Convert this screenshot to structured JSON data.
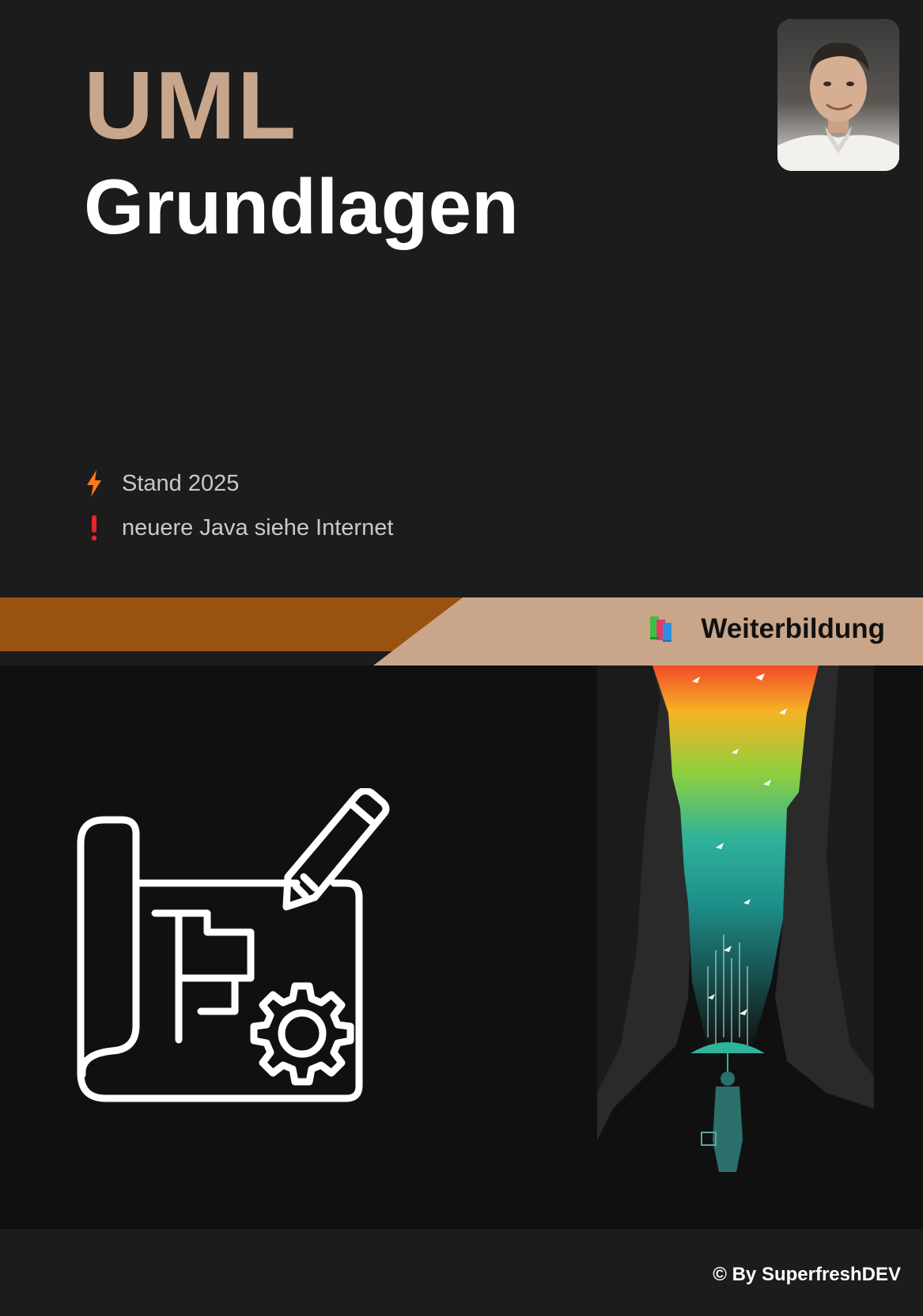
{
  "title": {
    "main": "UML",
    "sub": "Grundlagen"
  },
  "meta": [
    {
      "icon": "lightning-icon",
      "text": "Stand 2025",
      "color": "#ff7a1a"
    },
    {
      "icon": "exclamation-icon",
      "text": "neuere Java siehe Internet",
      "color": "#e8242c"
    }
  ],
  "band": {
    "label": "Weiterbildung",
    "icon": "books-icon"
  },
  "footer": {
    "text": "© By SuperfreshDEV"
  },
  "colors": {
    "accent": "#c8a68b",
    "band_dark": "#9a5210",
    "band_light": "#c9a68a",
    "background": "#1c1c1c",
    "lower_background": "#101010"
  }
}
